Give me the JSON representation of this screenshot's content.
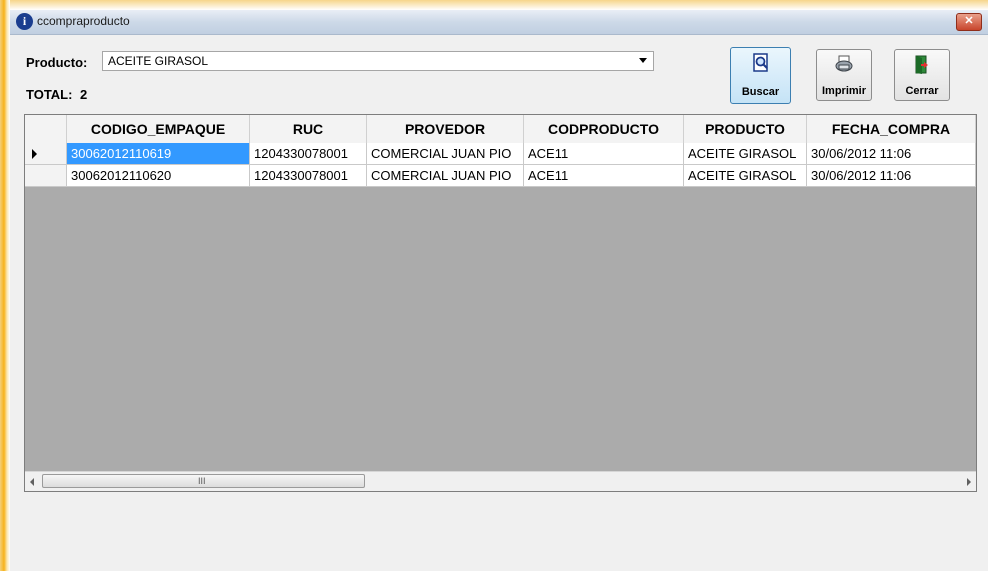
{
  "window": {
    "title": "ccompraproducto",
    "icon": "info-icon",
    "close_icon": "close-icon"
  },
  "filters": {
    "producto_label": "Producto:",
    "producto_value": "ACEITE GIRASOL",
    "total_label": "TOTAL:",
    "total_value": "2"
  },
  "toolbar": {
    "buscar": {
      "label": "Buscar",
      "icon": "magnifier-document-icon"
    },
    "imprimir": {
      "label": "Imprimir",
      "icon": "printer-icon"
    },
    "cerrar": {
      "label": "Cerrar",
      "icon": "exit-door-icon"
    }
  },
  "grid": {
    "columns": [
      "CODIGO_EMPAQUE",
      "RUC",
      "PROVEDOR",
      "CODPRODUCTO",
      "PRODUCTO",
      "FECHA_COMPRA"
    ],
    "rows": [
      [
        "30062012110619",
        "1204330078001",
        "COMERCIAL JUAN PIO",
        "ACE11",
        "ACEITE GIRASOL",
        "30/06/2012 11:06"
      ],
      [
        "30062012110620",
        "1204330078001",
        "COMERCIAL JUAN PIO",
        "ACE11",
        "ACEITE GIRASOL",
        "30/06/2012 11:06"
      ]
    ],
    "scrollbar_grip": "III"
  },
  "colors": {
    "selection": "#3399ff",
    "grid_background": "#ababab",
    "client_background": "#f0f0f0"
  }
}
